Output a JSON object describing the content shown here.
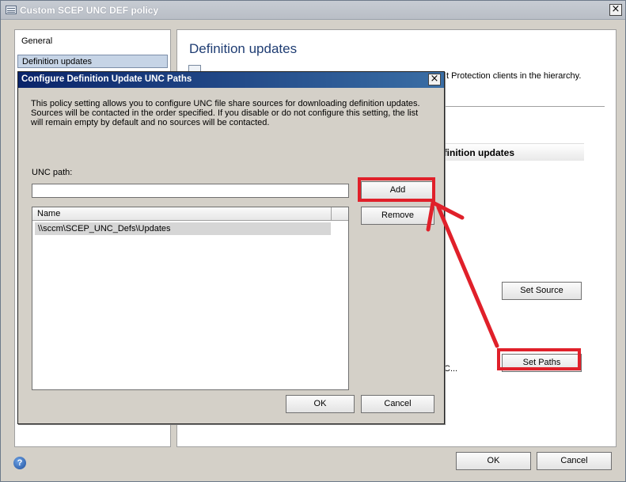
{
  "window": {
    "title": "Custom SCEP UNC DEF policy",
    "close_glyph": "×"
  },
  "nav": {
    "items": [
      {
        "label": "General",
        "selected": false
      },
      {
        "label": "Definition updates",
        "selected": true
      }
    ]
  },
  "content": {
    "heading": "Definition updates",
    "description_fragment": "t Protection clients in the hierarchy.",
    "group_fragment": "efinition updates",
    "truncated_fragment": "C...",
    "set_source_label": "Set Source",
    "set_paths_label": "Set Paths"
  },
  "footer": {
    "help_glyph": "?",
    "ok_label": "OK",
    "cancel_label": "Cancel"
  },
  "dialog": {
    "title": "Configure Definition Update UNC Paths",
    "close_glyph": "×",
    "description": "This policy setting allows you to configure UNC file share sources for downloading definition updates. Sources will be contacted in the order specified. If you disable or do not configure this setting, the list will remain empty by default and no sources will be contacted.",
    "unc_label": "UNC path:",
    "unc_value": "",
    "add_label": "Add",
    "remove_label": "Remove",
    "list": {
      "column_name": "Name",
      "rows": [
        "\\\\sccm\\SCEP_UNC_Defs\\Updates"
      ]
    },
    "ok_label": "OK",
    "cancel_label": "Cancel"
  },
  "annotation": {
    "color": "#e0202a"
  },
  "icons": {
    "window_icon": "policy-window-icon",
    "help": "help-icon",
    "close": "close-icon"
  }
}
